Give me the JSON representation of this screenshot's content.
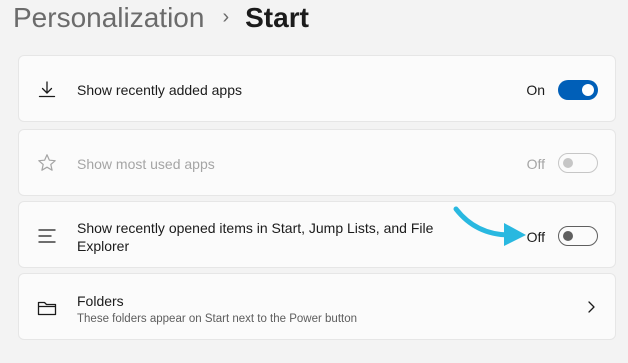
{
  "breadcrumb": {
    "parent": "Personalization",
    "separator": "›",
    "current": "Start"
  },
  "settings": [
    {
      "label": "Show recently added apps",
      "state": "On",
      "enabled": true,
      "icon": "download-icon"
    },
    {
      "label": "Show most used apps",
      "state": "Off",
      "enabled": false,
      "icon": "star-icon"
    },
    {
      "label_line1": "Show recently opened items in Start, Jump Lists, and File",
      "label_line2": "Explorer",
      "state": "Off",
      "enabled": true,
      "icon": "list-icon"
    }
  ],
  "folders": {
    "label": "Folders",
    "description": "These folders appear on Start next to the Power button",
    "icon": "folder-icon"
  },
  "colors": {
    "accent": "#005fb8",
    "annotation_arrow": "#29b8e0"
  }
}
